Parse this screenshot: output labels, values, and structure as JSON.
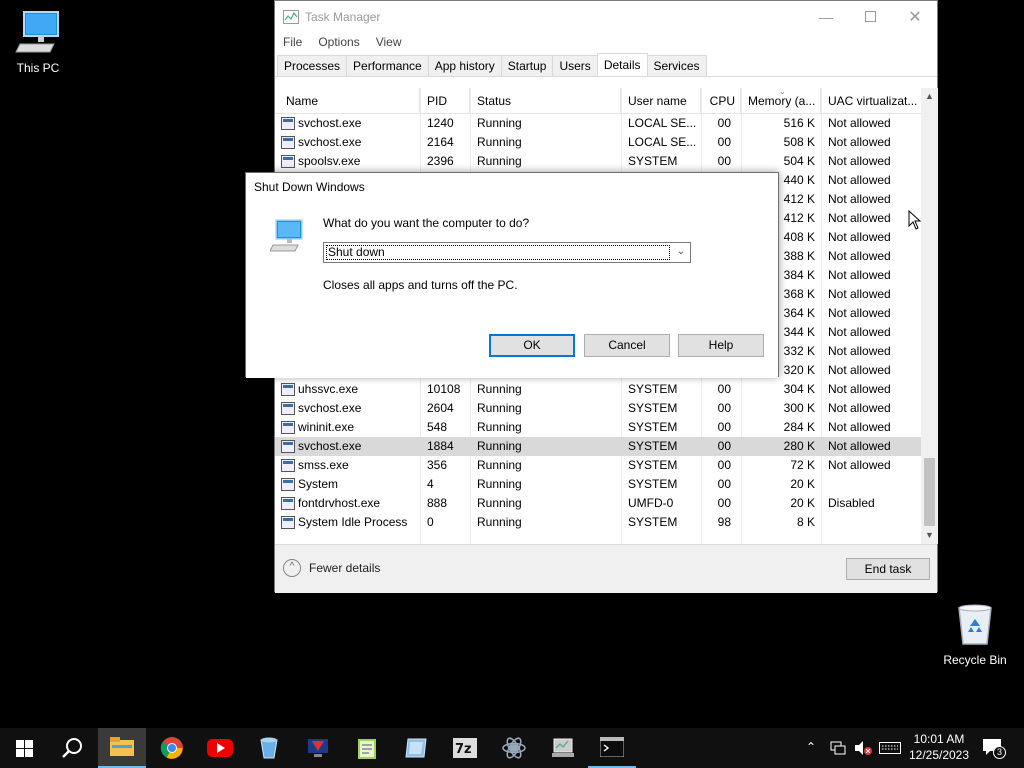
{
  "desktop": {
    "icons": [
      {
        "label": "This PC",
        "icon": "computer-icon"
      },
      {
        "label": "Recycle Bin",
        "icon": "recycle-bin-icon"
      }
    ]
  },
  "task_manager": {
    "title": "Task Manager",
    "menu": [
      "File",
      "Options",
      "View"
    ],
    "tabs": [
      "Processes",
      "Performance",
      "App history",
      "Startup",
      "Users",
      "Details",
      "Services"
    ],
    "active_tab": "Details",
    "columns": [
      "Name",
      "PID",
      "Status",
      "User name",
      "CPU",
      "Memory (a...",
      "UAC virtualizat..."
    ],
    "rows": [
      {
        "name": "svchost.exe",
        "pid": "1240",
        "status": "Running",
        "user": "LOCAL SE...",
        "cpu": "00",
        "mem": "516 K",
        "uac": "Not allowed"
      },
      {
        "name": "svchost.exe",
        "pid": "2164",
        "status": "Running",
        "user": "LOCAL SE...",
        "cpu": "00",
        "mem": "508 K",
        "uac": "Not allowed"
      },
      {
        "name": "spoolsv.exe",
        "pid": "2396",
        "status": "Running",
        "user": "SYSTEM",
        "cpu": "00",
        "mem": "504 K",
        "uac": "Not allowed"
      },
      {
        "name": "",
        "pid": "",
        "status": "",
        "user": "",
        "cpu": "",
        "mem": "440 K",
        "uac": "Not allowed"
      },
      {
        "name": "",
        "pid": "",
        "status": "",
        "user": "",
        "cpu": "",
        "mem": "412 K",
        "uac": "Not allowed"
      },
      {
        "name": "",
        "pid": "",
        "status": "",
        "user": "",
        "cpu": "",
        "mem": "412 K",
        "uac": "Not allowed"
      },
      {
        "name": "",
        "pid": "",
        "status": "",
        "user": "",
        "cpu": "",
        "mem": "408 K",
        "uac": "Not allowed"
      },
      {
        "name": "",
        "pid": "",
        "status": "",
        "user": "",
        "cpu": "",
        "mem": "388 K",
        "uac": "Not allowed"
      },
      {
        "name": "",
        "pid": "",
        "status": "",
        "user": "",
        "cpu": "",
        "mem": "384 K",
        "uac": "Not allowed"
      },
      {
        "name": "",
        "pid": "",
        "status": "",
        "user": "",
        "cpu": "",
        "mem": "368 K",
        "uac": "Not allowed"
      },
      {
        "name": "",
        "pid": "",
        "status": "",
        "user": "",
        "cpu": "",
        "mem": "364 K",
        "uac": "Not allowed"
      },
      {
        "name": "",
        "pid": "",
        "status": "",
        "user": "",
        "cpu": "",
        "mem": "344 K",
        "uac": "Not allowed"
      },
      {
        "name": "",
        "pid": "",
        "status": "",
        "user": "",
        "cpu": "",
        "mem": "332 K",
        "uac": "Not allowed"
      },
      {
        "name": "",
        "pid": "",
        "status": "",
        "user": "",
        "cpu": "",
        "mem": "320 K",
        "uac": "Not allowed"
      },
      {
        "name": "uhssvc.exe",
        "pid": "10108",
        "status": "Running",
        "user": "SYSTEM",
        "cpu": "00",
        "mem": "304 K",
        "uac": "Not allowed"
      },
      {
        "name": "svchost.exe",
        "pid": "2604",
        "status": "Running",
        "user": "SYSTEM",
        "cpu": "00",
        "mem": "300 K",
        "uac": "Not allowed"
      },
      {
        "name": "wininit.exe",
        "pid": "548",
        "status": "Running",
        "user": "SYSTEM",
        "cpu": "00",
        "mem": "284 K",
        "uac": "Not allowed"
      },
      {
        "name": "svchost.exe",
        "pid": "1884",
        "status": "Running",
        "user": "SYSTEM",
        "cpu": "00",
        "mem": "280 K",
        "uac": "Not allowed",
        "selected": true
      },
      {
        "name": "smss.exe",
        "pid": "356",
        "status": "Running",
        "user": "SYSTEM",
        "cpu": "00",
        "mem": "72 K",
        "uac": "Not allowed"
      },
      {
        "name": "System",
        "pid": "4",
        "status": "Running",
        "user": "SYSTEM",
        "cpu": "00",
        "mem": "20 K",
        "uac": ""
      },
      {
        "name": "fontdrvhost.exe",
        "pid": "888",
        "status": "Running",
        "user": "UMFD-0",
        "cpu": "00",
        "mem": "20 K",
        "uac": "Disabled"
      },
      {
        "name": "System Idle Process",
        "pid": "0",
        "status": "Running",
        "user": "SYSTEM",
        "cpu": "98",
        "mem": "8 K",
        "uac": ""
      }
    ],
    "fewer_details": "Fewer details",
    "end_task": "End task"
  },
  "shutdown_dialog": {
    "title": "Shut Down Windows",
    "question": "What do you want the computer to do?",
    "selected_option": "Shut down",
    "description": "Closes all apps and turns off the PC.",
    "ok": "OK",
    "cancel": "Cancel",
    "help": "Help"
  },
  "taskbar": {
    "apps": [
      "start-icon",
      "search-icon",
      "file-explorer-icon",
      "chrome-icon",
      "youtube-icon",
      "app-icon",
      "app-icon",
      "notepad-icon",
      "app-icon",
      "7zip-icon",
      "app-icon",
      "app-icon",
      "terminal-icon"
    ],
    "time": "10:01 AM",
    "date": "12/25/2023",
    "notification_count": "3"
  },
  "colors": {
    "accent": "#0078d7",
    "taskbar": "#101010",
    "selected_row": "#d9d9d9"
  }
}
